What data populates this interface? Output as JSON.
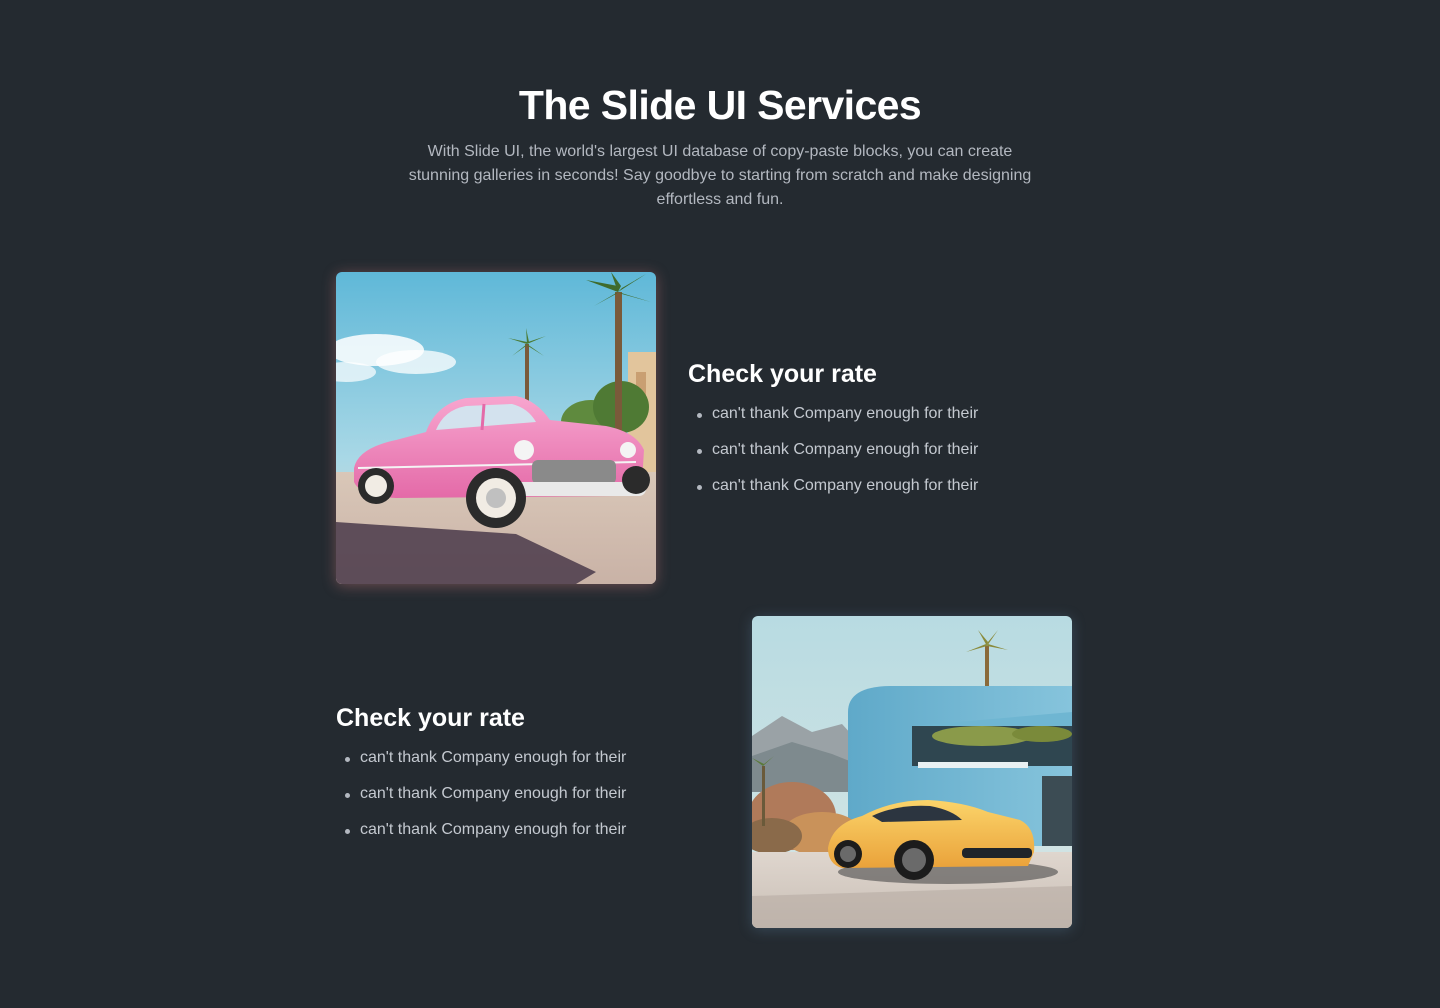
{
  "header": {
    "title": "The Slide UI Services",
    "subtitle": "With Slide UI, the world's largest UI database of copy-paste blocks, you can create stunning galleries in seconds! Say goodbye to starting from scratch and make designing effortless and fun."
  },
  "features": [
    {
      "image": "pink-vintage-car-photo",
      "heading": "Check your rate",
      "items": [
        "can't thank Company enough for their",
        "can't thank Company enough for their",
        "can't thank Company enough for their"
      ]
    },
    {
      "image": "yellow-sports-car-photo",
      "heading": "Check your rate",
      "items": [
        "can't thank Company enough for their",
        "can't thank Company enough for their",
        "can't thank Company enough for their"
      ]
    }
  ],
  "colors": {
    "background": "#242a30",
    "heading": "#ffffff",
    "body_text": "#c4c9d0"
  }
}
